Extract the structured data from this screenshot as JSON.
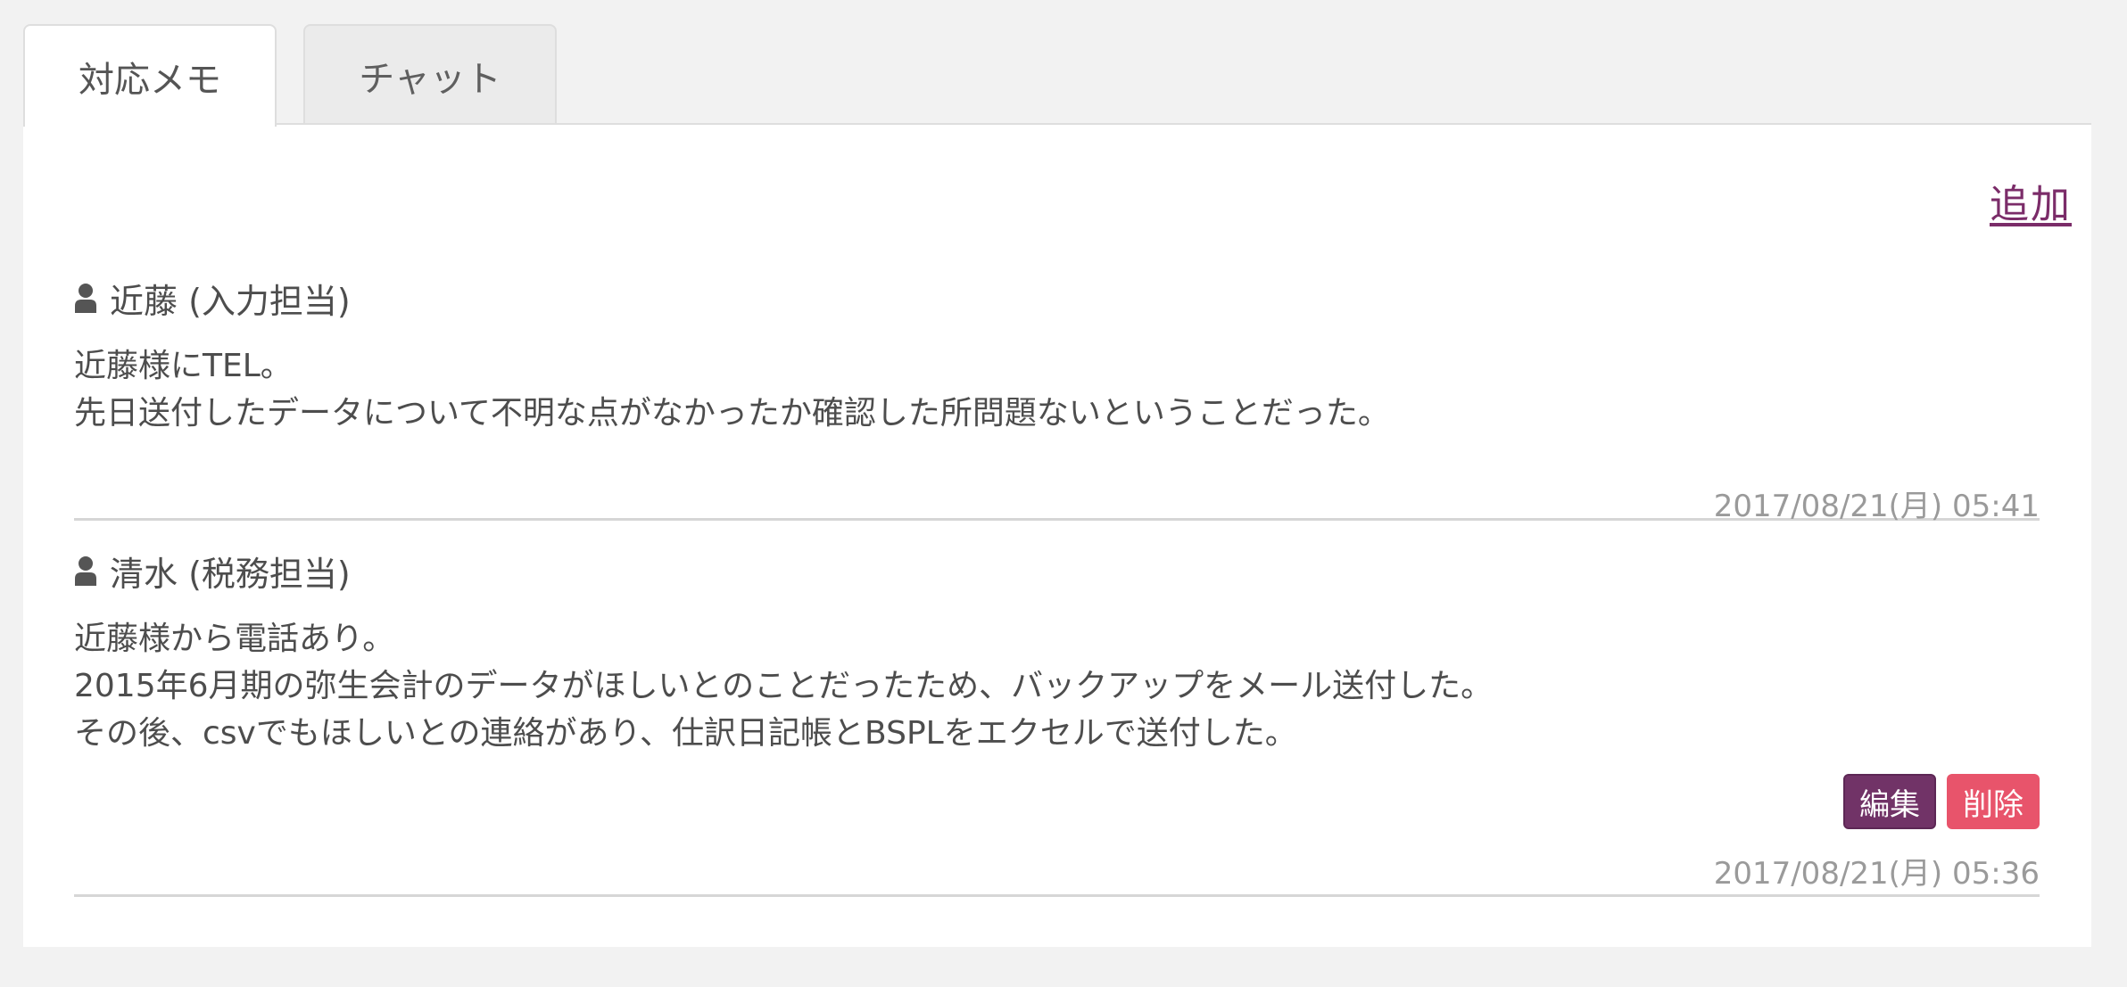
{
  "tabs": [
    {
      "label": "対応メモ",
      "active": true
    },
    {
      "label": "チャット",
      "active": false
    }
  ],
  "panel": {
    "add_label": "追加"
  },
  "memos": [
    {
      "author": "近藤 (入力担当)",
      "body": "近藤様にTEL。\n先日送付したデータについて不明な点がなかったか確認した所問題ないということだった。",
      "timestamp": "2017/08/21(月) 05:41"
    },
    {
      "author": "清水 (税務担当)",
      "body": "近藤様から電話あり。\n2015年6月期の弥生会計のデータがほしいとのことだったため、バックアップをメール送付した。\nその後、csvでもほしいとの連絡があり、仕訳日記帳とBSPLをエクセルで送付した。",
      "timestamp": "2017/08/21(月) 05:36",
      "edit_label": "編集",
      "delete_label": "削除"
    }
  ],
  "icons": {
    "author": "user-icon"
  },
  "colors": {
    "accent": "#7b2c69",
    "edit_button": "#713367",
    "delete_button": "#e8546b",
    "background": "#f2f2f2"
  }
}
